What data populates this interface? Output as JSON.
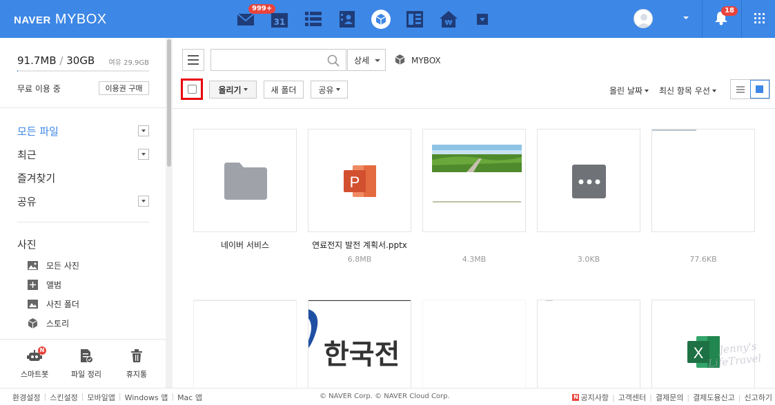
{
  "brand": {
    "naver": "NAVER",
    "product": "MYBOX"
  },
  "header": {
    "mail_badge": "999+",
    "calendar_day": "31",
    "bell_badge": "18"
  },
  "storage": {
    "used": "91.7MB",
    "total": "30GB",
    "free": "여유 29.9GB",
    "plan": "무료 이용 중",
    "buy_label": "이용권 구매",
    "used_fraction": 0.003
  },
  "nav": {
    "all_files": "모든 파일",
    "recent": "최근",
    "favorites": "즐겨찾기",
    "shared": "공유"
  },
  "photos": {
    "title": "사진",
    "items": [
      "모든 사진",
      "앨범",
      "사진 폴더",
      "스토리"
    ]
  },
  "tools": {
    "smartbot": "스마트봇",
    "cleanup": "파일 정리",
    "trash": "휴지통",
    "smartbot_badge": "N"
  },
  "toolbar": {
    "search_placeholder": "",
    "detail_label": "상세",
    "breadcrumb": "MYBOX",
    "upload_label": "올리기",
    "new_folder_label": "새 폴더",
    "share_label": "공유",
    "sort_date_label": "올린 날짜",
    "sort_order_label": "최신 항목 우선"
  },
  "files": [
    {
      "name": "네이버 서비스",
      "size": ""
    },
    {
      "name": "연료전지 발전 계획서.pptx",
      "size": "6.8MB"
    },
    {
      "name": "",
      "size": "4.3MB"
    },
    {
      "name": "",
      "size": "3.0KB"
    },
    {
      "name": "",
      "size": "77.6KB"
    }
  ],
  "row2_text": {
    "korean_partial": "한국전"
  },
  "footer": {
    "left": [
      "환경설정",
      "스킨설정",
      "모바일앱",
      "Windows 앱",
      "Mac 앱"
    ],
    "center": "© NAVER Corp. © NAVER Cloud Corp.",
    "right": [
      "공지사항",
      "고객센터",
      "결제문의",
      "결제도용신고",
      "신고하기"
    ]
  },
  "watermark": {
    "line1": "Jenny's",
    "line2": "LifeTravel"
  },
  "colors": {
    "header_blue": "#3d87e6",
    "accent_red": "#e8000b",
    "ppt_orange": "#d2502f",
    "excel_green": "#1e7145"
  }
}
